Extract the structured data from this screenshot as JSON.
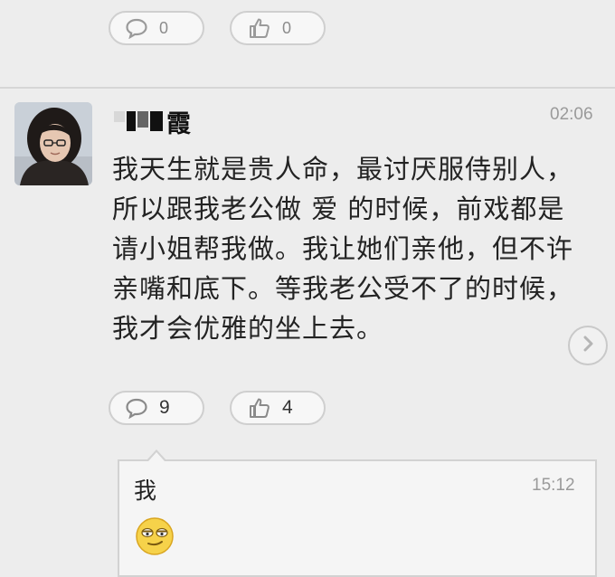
{
  "top_actions": {
    "comment_count": "0",
    "like_count": "0"
  },
  "post": {
    "username_visible": "霞",
    "time": "02:06",
    "text": "我天生就是贵人命，最讨厌服侍别人，所以跟我老公做 爱 的时候，前戏都是请小姐帮我做。我让她们亲他，但不许亲嘴和底下。等我老公受不了的时候，我才会优雅的坐上去。",
    "comment_count": "9",
    "like_count": "4"
  },
  "reply": {
    "text": "我",
    "time": "15:12",
    "emoji": "smug-face-emoji"
  },
  "icons": {
    "comment": "speech-bubble-icon",
    "like": "thumbs-up-icon",
    "next": "chevron-right-icon"
  },
  "colors": {
    "background": "#ededed",
    "pill_border": "#cfcfcf",
    "muted_text": "#9a9a9a",
    "reply_bg": "#f5f5f5"
  }
}
